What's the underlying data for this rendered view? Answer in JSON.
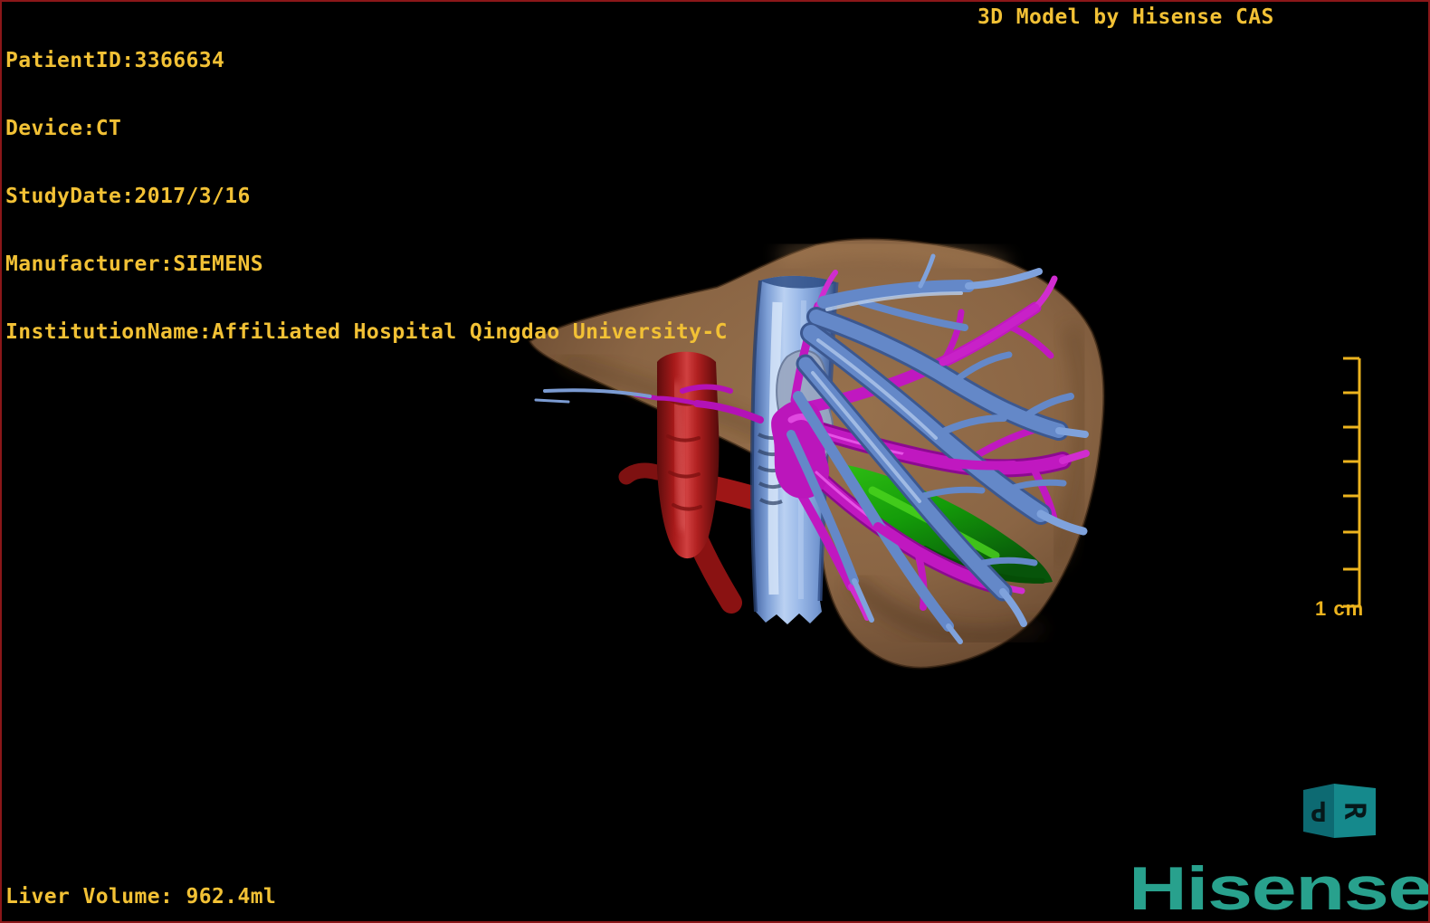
{
  "window": {
    "background_color": "#000000",
    "border_color": "#8b1719"
  },
  "overlay": {
    "text_color": "#f2c135",
    "top_left_lines": [
      "PatientID:3366634",
      "Device:CT",
      "StudyDate:2017/3/16",
      "Manufacturer:SIEMENS",
      "InstitutionName:Affiliated Hospital Qingdao University-C"
    ],
    "top_right_label": "3D Model by Hisense CAS",
    "bottom_left_label": "Liver Volume: 962.4ml"
  },
  "scale_bar": {
    "label": "1 cm",
    "color": "#ecb31e",
    "tick_count": 8
  },
  "orientation_cube": {
    "left_letter": "P",
    "right_letter": "R",
    "left_face_color": "#0d6a72",
    "right_face_color": "#15898c",
    "letter_color": "#06181a"
  },
  "logo": {
    "text": "Hisense",
    "color": "#28a18d"
  },
  "model": {
    "structures": [
      {
        "name": "liver",
        "color": "#8a6544"
      },
      {
        "name": "inferior-vena-cava",
        "color": "#8fb0e2"
      },
      {
        "name": "portal-and-hepatic-veins",
        "color": "#5f82c4"
      },
      {
        "name": "aorta-hepatic-artery",
        "color": "#b01c1c"
      },
      {
        "name": "magenta-vessel-tree",
        "color": "#c018c0"
      },
      {
        "name": "gallbladder",
        "color": "#139a0a"
      }
    ]
  }
}
